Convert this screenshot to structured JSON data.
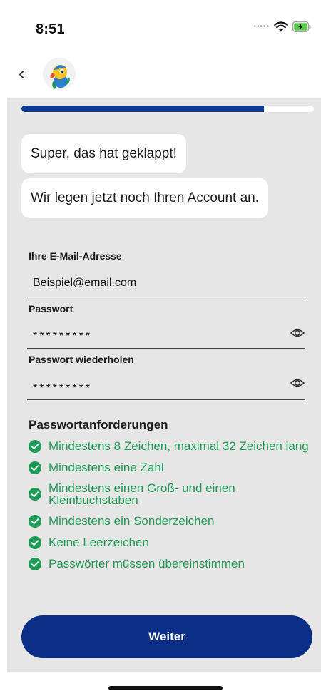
{
  "status": {
    "time": "8:51",
    "battery_color": "#5cc84a"
  },
  "nav": {
    "back_icon": "chevron-left-icon",
    "avatar_icon": "parrot-mascot-icon"
  },
  "progress": {
    "value": 0.83,
    "color": "#0e3a8f"
  },
  "chat": {
    "messages": [
      "Super, das hat geklappt!",
      "Wir legen jetzt noch Ihren Account an."
    ]
  },
  "form": {
    "email_label": "Ihre E-Mail-Adresse",
    "email_value": "Beispiel@email.com",
    "password_label": "Passwort",
    "password_value": "*********",
    "repeat_label": "Passwort wiederholen",
    "repeat_value": "*********"
  },
  "requirements": {
    "title": "Passwortanforderungen",
    "items": [
      "Mindestens 8 Zeichen, maximal 32 Zeichen lang",
      "Mindestens eine Zahl",
      "Mindestens einen Groß- und einen Kleinbuchstaben",
      "Mindestens ein Sonderzeichen",
      "Keine Leerzeichen",
      "Passwörter müssen übereinstimmen"
    ],
    "color": "#1d9a55"
  },
  "cta": {
    "label": "Weiter",
    "color": "#0b2f86"
  }
}
